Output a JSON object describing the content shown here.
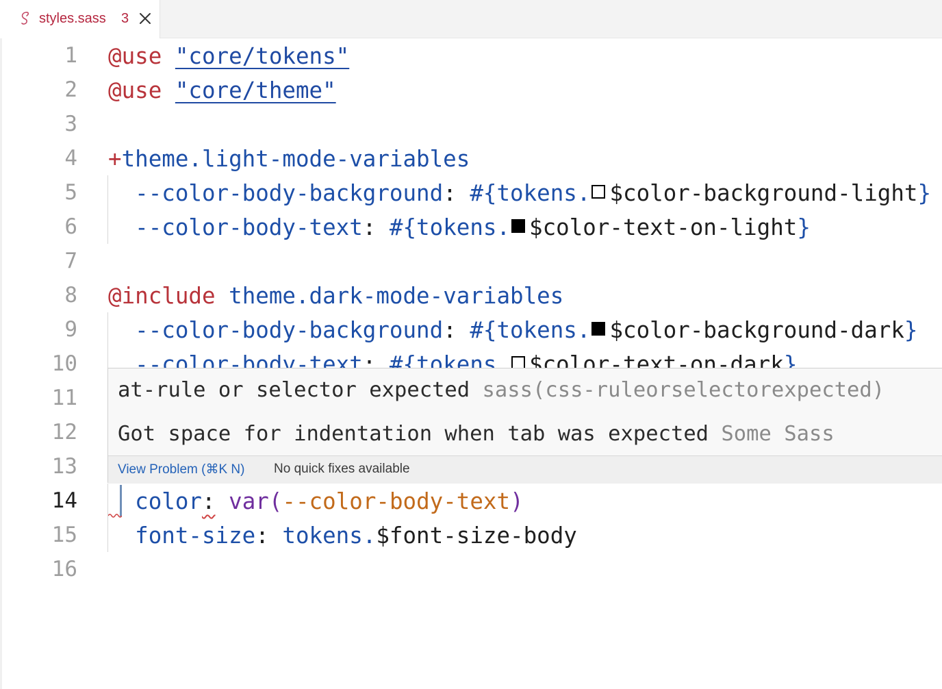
{
  "tab": {
    "icon": "sass-file-icon",
    "filename": "styles.sass",
    "problem_count": "3",
    "close_icon": "close-icon",
    "label_color": "#b5263f"
  },
  "editor": {
    "active_line": 14,
    "lines": [
      {
        "number": "1",
        "tokens": [
          {
            "c": "t-at",
            "t": "@use"
          },
          {
            "c": "t-punc",
            "t": " "
          },
          {
            "c": "t-str",
            "t": "\"core/tokens\""
          }
        ]
      },
      {
        "number": "2",
        "tokens": [
          {
            "c": "t-at",
            "t": "@use"
          },
          {
            "c": "t-punc",
            "t": " "
          },
          {
            "c": "t-str",
            "t": "\"core/theme\""
          }
        ]
      },
      {
        "number": "3",
        "tokens": []
      },
      {
        "number": "4",
        "tokens": [
          {
            "c": "t-at",
            "t": "+"
          },
          {
            "c": "t-ident",
            "t": "theme.light-mode-variables"
          }
        ]
      },
      {
        "number": "5",
        "tokens": [
          {
            "c": "t-punc",
            "t": "  "
          },
          {
            "c": "t-prop",
            "t": "--color-body-background"
          },
          {
            "c": "t-punc",
            "t": ": "
          },
          {
            "c": "t-ident",
            "t": "#{tokens."
          },
          {
            "swatch": "light"
          },
          {
            "c": "t-var",
            "t": "$color-background-light"
          },
          {
            "c": "t-ident",
            "t": "}"
          }
        ]
      },
      {
        "number": "6",
        "tokens": [
          {
            "c": "t-punc",
            "t": "  "
          },
          {
            "c": "t-prop",
            "t": "--color-body-text"
          },
          {
            "c": "t-punc",
            "t": ": "
          },
          {
            "c": "t-ident",
            "t": "#{tokens."
          },
          {
            "swatch": "dark"
          },
          {
            "c": "t-var",
            "t": "$color-text-on-light"
          },
          {
            "c": "t-ident",
            "t": "}"
          }
        ]
      },
      {
        "number": "7",
        "tokens": []
      },
      {
        "number": "8",
        "tokens": [
          {
            "c": "t-at",
            "t": "@include"
          },
          {
            "c": "t-punc",
            "t": " "
          },
          {
            "c": "t-ident",
            "t": "theme.dark-mode-variables"
          }
        ]
      },
      {
        "number": "9",
        "tokens": [
          {
            "c": "t-punc",
            "t": "  "
          },
          {
            "c": "t-prop",
            "t": "--color-body-background"
          },
          {
            "c": "t-punc",
            "t": ": "
          },
          {
            "c": "t-ident",
            "t": "#{tokens."
          },
          {
            "swatch": "dark"
          },
          {
            "c": "t-var",
            "t": "$color-background-dark"
          },
          {
            "c": "t-ident",
            "t": "}"
          }
        ]
      },
      {
        "number": "10",
        "tokens": [
          {
            "c": "t-punc",
            "t": "  "
          },
          {
            "c": "t-prop",
            "t": "--color-body-text"
          },
          {
            "c": "t-punc",
            "t": ": "
          },
          {
            "c": "t-ident",
            "t": "#{tokens."
          },
          {
            "swatch": "light"
          },
          {
            "c": "t-var",
            "t": "$color-text-on-dark"
          },
          {
            "c": "t-ident",
            "t": "}"
          }
        ]
      },
      {
        "number": "11",
        "tokens": []
      },
      {
        "number": "12",
        "tokens": []
      },
      {
        "number": "13",
        "tokens": []
      },
      {
        "number": "14",
        "tokens": [
          {
            "c": "t-punc",
            "t": "  "
          },
          {
            "c": "t-prop",
            "t": "color"
          },
          {
            "c": "t-punc t-squig",
            "t": ":"
          },
          {
            "c": "t-punc",
            "t": " "
          },
          {
            "c": "t-fn",
            "t": "var("
          },
          {
            "c": "t-orange",
            "t": "--color-body-text"
          },
          {
            "c": "t-fn",
            "t": ")"
          }
        ]
      },
      {
        "number": "15",
        "tokens": [
          {
            "c": "t-punc",
            "t": "  "
          },
          {
            "c": "t-prop",
            "t": "font-size"
          },
          {
            "c": "t-punc",
            "t": ": "
          },
          {
            "c": "t-ident",
            "t": "tokens."
          },
          {
            "c": "t-var",
            "t": "$font-size-body"
          }
        ]
      },
      {
        "number": "16",
        "tokens": []
      }
    ]
  },
  "hover": {
    "problems": [
      {
        "message": "at-rule or selector expected",
        "source": "sass(css-ruleorselectorexpected)"
      },
      {
        "message": "Got space for indentation when tab was expected",
        "source": "Some Sass"
      }
    ],
    "view_problem": "View Problem (⌘K N)",
    "no_quick_fixes": "No quick fixes available"
  },
  "colors": {
    "error_squiggle": "#d04545",
    "link": "#2462b8"
  }
}
